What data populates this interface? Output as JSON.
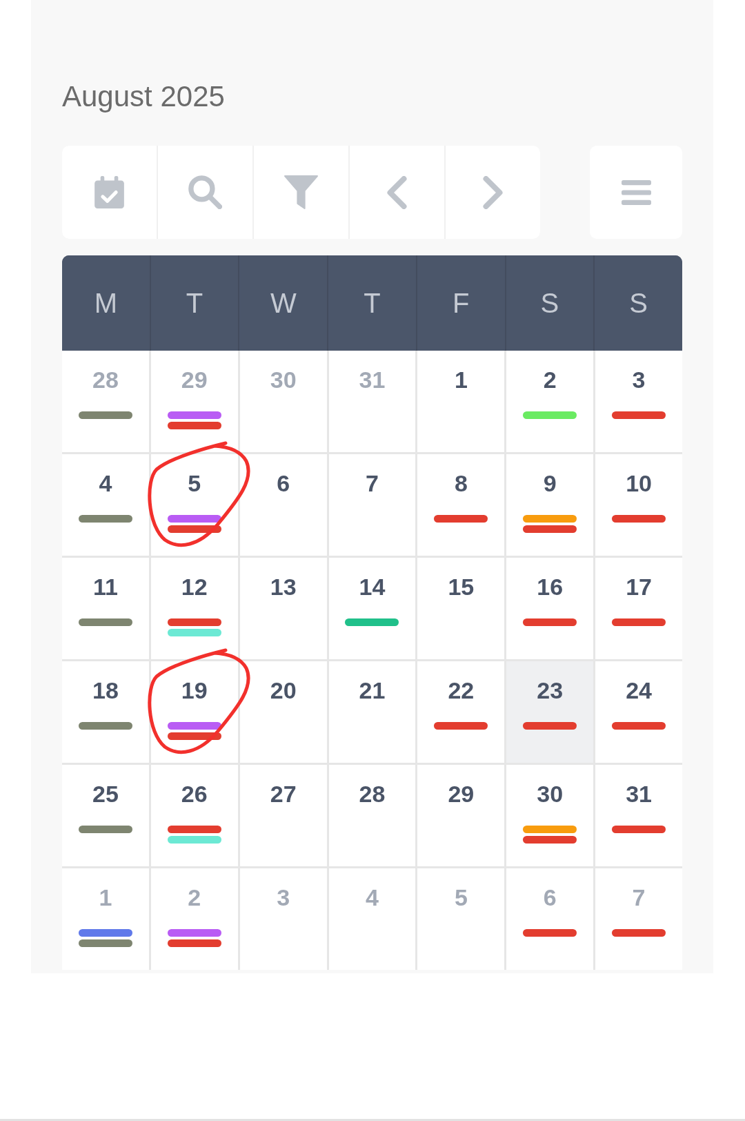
{
  "title": "August 2025",
  "weekdays": [
    "M",
    "T",
    "W",
    "T",
    "F",
    "S",
    "S"
  ],
  "weeks": [
    [
      {
        "label": "28",
        "muted": true,
        "selected": false,
        "circled": false,
        "events": [
          {
            "color": "#7e8570"
          }
        ]
      },
      {
        "label": "29",
        "muted": true,
        "selected": false,
        "circled": false,
        "events": [
          {
            "color": "#b95cf4"
          },
          {
            "color": "#e33d2f"
          }
        ]
      },
      {
        "label": "30",
        "muted": true,
        "selected": false,
        "circled": false
      },
      {
        "label": "31",
        "muted": true,
        "selected": false,
        "circled": false
      },
      {
        "label": "1",
        "muted": false,
        "selected": false,
        "circled": false
      },
      {
        "label": "2",
        "muted": false,
        "selected": false,
        "circled": false,
        "events": [
          {
            "color": "#6aeb62"
          }
        ]
      },
      {
        "label": "3",
        "muted": false,
        "selected": false,
        "circled": false,
        "events": [
          {
            "color": "#e33d2f"
          }
        ]
      }
    ],
    [
      {
        "label": "4",
        "muted": false,
        "selected": false,
        "circled": false,
        "events": [
          {
            "color": "#7e8570"
          }
        ]
      },
      {
        "label": "5",
        "muted": false,
        "selected": false,
        "circled": true,
        "events": [
          {
            "color": "#b95cf4"
          },
          {
            "color": "#e33d2f"
          }
        ]
      },
      {
        "label": "6",
        "muted": false,
        "selected": false,
        "circled": false
      },
      {
        "label": "7",
        "muted": false,
        "selected": false,
        "circled": false
      },
      {
        "label": "8",
        "muted": false,
        "selected": false,
        "circled": false,
        "events": [
          {
            "color": "#e33d2f"
          }
        ]
      },
      {
        "label": "9",
        "muted": false,
        "selected": false,
        "circled": false,
        "events": [
          {
            "color": "#f89c0e"
          },
          {
            "color": "#e33d2f"
          }
        ]
      },
      {
        "label": "10",
        "muted": false,
        "selected": false,
        "circled": false,
        "events": [
          {
            "color": "#e33d2f"
          }
        ]
      }
    ],
    [
      {
        "label": "11",
        "muted": false,
        "selected": false,
        "circled": false,
        "events": [
          {
            "color": "#7e8570"
          }
        ]
      },
      {
        "label": "12",
        "muted": false,
        "selected": false,
        "circled": false,
        "events": [
          {
            "color": "#e33d2f"
          },
          {
            "color": "#6ce9d4"
          }
        ]
      },
      {
        "label": "13",
        "muted": false,
        "selected": false,
        "circled": false
      },
      {
        "label": "14",
        "muted": false,
        "selected": false,
        "circled": false,
        "events": [
          {
            "color": "#20c08a"
          }
        ]
      },
      {
        "label": "15",
        "muted": false,
        "selected": false,
        "circled": false
      },
      {
        "label": "16",
        "muted": false,
        "selected": false,
        "circled": false,
        "events": [
          {
            "color": "#e33d2f"
          }
        ]
      },
      {
        "label": "17",
        "muted": false,
        "selected": false,
        "circled": false,
        "events": [
          {
            "color": "#e33d2f"
          }
        ]
      }
    ],
    [
      {
        "label": "18",
        "muted": false,
        "selected": false,
        "circled": false,
        "events": [
          {
            "color": "#7e8570"
          }
        ]
      },
      {
        "label": "19",
        "muted": false,
        "selected": false,
        "circled": true,
        "events": [
          {
            "color": "#b95cf4"
          },
          {
            "color": "#e33d2f"
          }
        ]
      },
      {
        "label": "20",
        "muted": false,
        "selected": false,
        "circled": false
      },
      {
        "label": "21",
        "muted": false,
        "selected": false,
        "circled": false
      },
      {
        "label": "22",
        "muted": false,
        "selected": false,
        "circled": false,
        "events": [
          {
            "color": "#e33d2f"
          }
        ]
      },
      {
        "label": "23",
        "muted": false,
        "selected": true,
        "circled": false,
        "events": [
          {
            "color": "#e33d2f"
          }
        ]
      },
      {
        "label": "24",
        "muted": false,
        "selected": false,
        "circled": false,
        "events": [
          {
            "color": "#e33d2f"
          }
        ]
      }
    ],
    [
      {
        "label": "25",
        "muted": false,
        "selected": false,
        "circled": false,
        "events": [
          {
            "color": "#7e8570"
          }
        ]
      },
      {
        "label": "26",
        "muted": false,
        "selected": false,
        "circled": false,
        "events": [
          {
            "color": "#e33d2f"
          },
          {
            "color": "#6ce9d4"
          }
        ]
      },
      {
        "label": "27",
        "muted": false,
        "selected": false,
        "circled": false
      },
      {
        "label": "28",
        "muted": false,
        "selected": false,
        "circled": false
      },
      {
        "label": "29",
        "muted": false,
        "selected": false,
        "circled": false
      },
      {
        "label": "30",
        "muted": false,
        "selected": false,
        "circled": false,
        "events": [
          {
            "color": "#f89c0e"
          },
          {
            "color": "#e33d2f"
          }
        ]
      },
      {
        "label": "31",
        "muted": false,
        "selected": false,
        "circled": false,
        "events": [
          {
            "color": "#e33d2f"
          }
        ]
      }
    ],
    [
      {
        "label": "1",
        "muted": true,
        "selected": false,
        "circled": false,
        "events": [
          {
            "color": "#6079ea"
          },
          {
            "color": "#7e8570"
          }
        ]
      },
      {
        "label": "2",
        "muted": true,
        "selected": false,
        "circled": false,
        "events": [
          {
            "color": "#b95cf4"
          },
          {
            "color": "#e33d2f"
          }
        ]
      },
      {
        "label": "3",
        "muted": true,
        "selected": false,
        "circled": false
      },
      {
        "label": "4",
        "muted": true,
        "selected": false,
        "circled": false
      },
      {
        "label": "5",
        "muted": true,
        "selected": false,
        "circled": false
      },
      {
        "label": "6",
        "muted": true,
        "selected": false,
        "circled": false,
        "events": [
          {
            "color": "#e33d2f"
          }
        ]
      },
      {
        "label": "7",
        "muted": true,
        "selected": false,
        "circled": false,
        "events": [
          {
            "color": "#e33d2f"
          }
        ]
      }
    ]
  ]
}
